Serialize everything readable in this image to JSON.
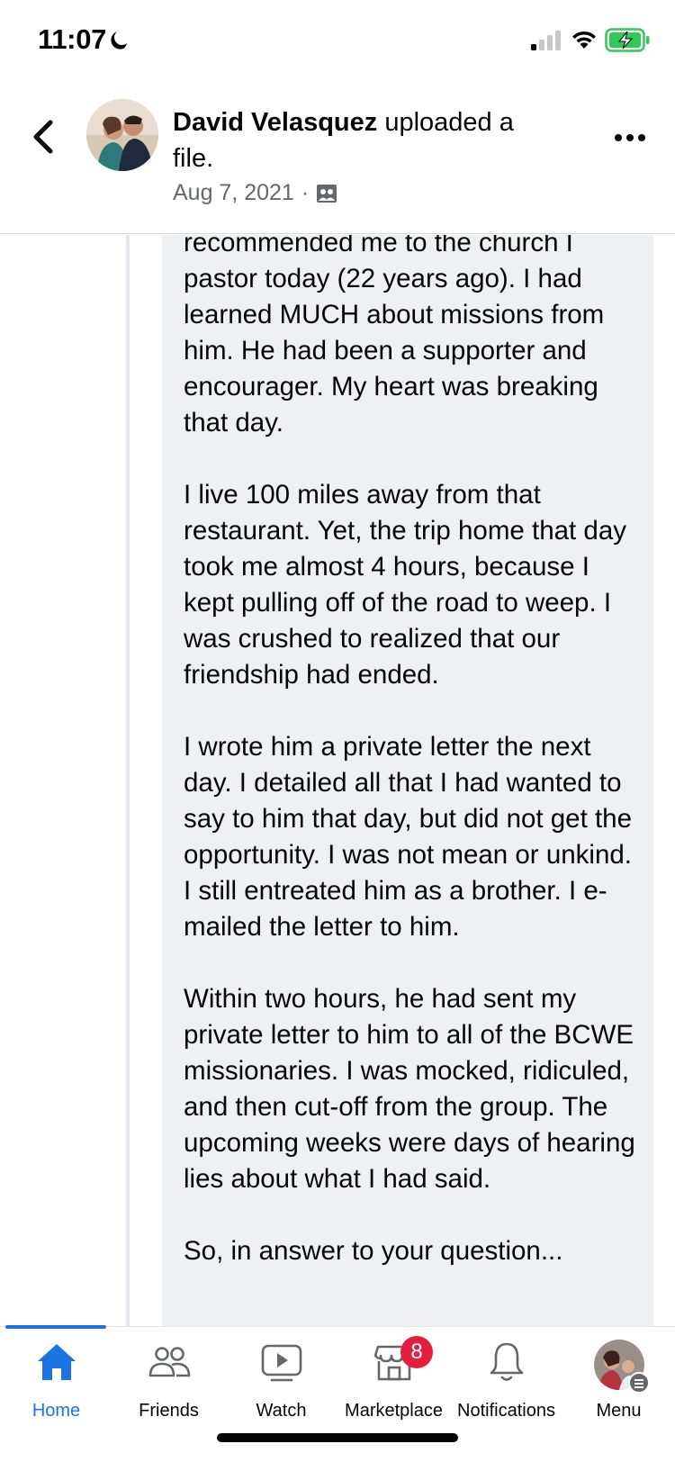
{
  "status_bar": {
    "time": "11:07"
  },
  "post_header": {
    "author": "David Velasquez",
    "action": "uploaded a file.",
    "date": "Aug 7, 2021",
    "separator": "·"
  },
  "comment": {
    "paragraphs": [
      "recommended me to the church I pastor today (22 years ago).  I had learned MUCH about missions from him.  He had been a supporter and encourager.  My heart was breaking that day.",
      "I live 100 miles away from that restaurant.  Yet, the trip home that day took me almost 4 hours, because I kept pulling off of the road to weep.  I was crushed to realized that our friendship had ended.",
      "I wrote him a private letter the next day.  I detailed all that I had wanted to say to him that day, but did not get the opportunity.  I was not mean or unkind.  I still entreated him as a brother.  I e-mailed the letter to him.",
      "Within two hours, he had sent my private letter to him to all of the BCWE missionaries.  I was mocked, ridiculed, and then cut-off from the group.  The upcoming weeks were days of hearing lies about what I had said.",
      "So, in answer to your question..."
    ]
  },
  "tab_bar": {
    "tabs": [
      {
        "label": "Home",
        "icon": "home-icon",
        "active": true
      },
      {
        "label": "Friends",
        "icon": "friends-icon"
      },
      {
        "label": "Watch",
        "icon": "watch-icon"
      },
      {
        "label": "Marketplace",
        "icon": "marketplace-icon",
        "badge": "8"
      },
      {
        "label": "Notifications",
        "icon": "bell-icon"
      },
      {
        "label": "Menu",
        "icon": "menu-avatar"
      }
    ]
  },
  "colors": {
    "accent": "#1b74e4",
    "badge": "#e41e3f",
    "bubble": "#eff0f3",
    "secondary_text": "#65676b"
  }
}
